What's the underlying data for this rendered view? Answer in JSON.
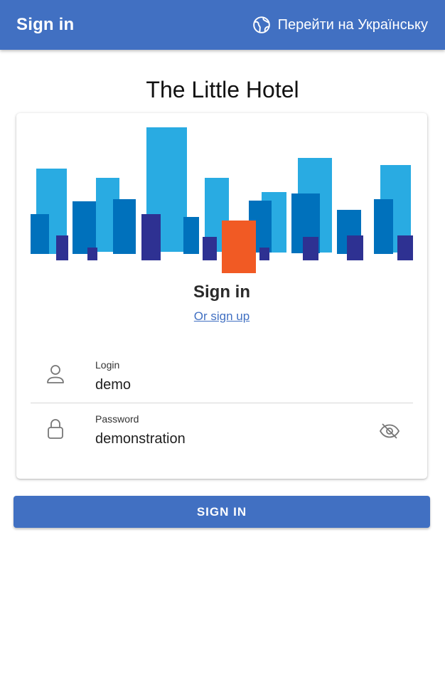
{
  "appbar": {
    "title": "Sign in",
    "language_link": "Перейти на Українську",
    "icon": "globe-icon"
  },
  "hotel_name": "The Little Hotel",
  "card": {
    "illustration": "city-skyline-illustration",
    "title": "Sign in",
    "signup_link": "Or sign up"
  },
  "form": {
    "login": {
      "label": "Login",
      "value": "demo",
      "icon": "user-icon"
    },
    "password": {
      "label": "Password",
      "value": "demonstration",
      "icon": "lock-icon",
      "toggle_icon": "eye-off-icon"
    }
  },
  "submit_label": "SIGN IN",
  "colors": {
    "primary": "#4170c2",
    "sky_light": "#29abe2",
    "sky_mid": "#0071bc",
    "sky_dark": "#2e3192",
    "accent": "#f15a24"
  }
}
